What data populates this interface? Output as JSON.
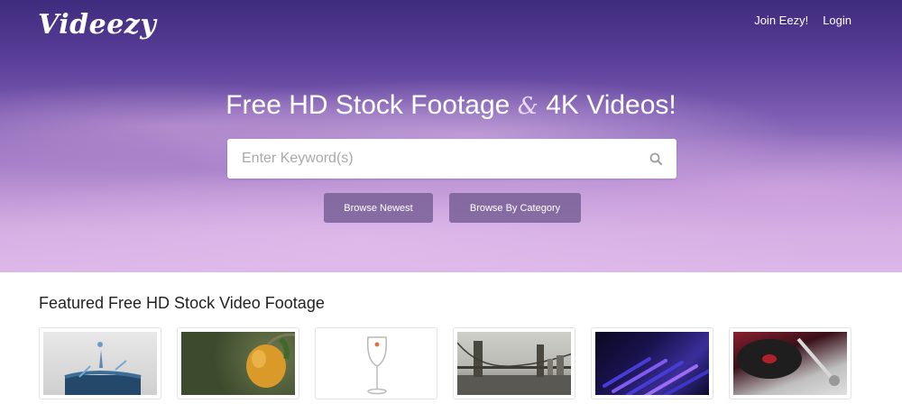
{
  "header": {
    "logo": "Videezy",
    "nav": [
      "Join Eezy!",
      "Login"
    ]
  },
  "hero": {
    "headline_part1": "Free HD Stock Footage",
    "headline_amp": "&",
    "headline_part2": "4K Videos!",
    "search_placeholder": "Enter Keyword(s)",
    "buttons": [
      "Browse Newest",
      "Browse By Category"
    ]
  },
  "featured": {
    "title": "Featured Free HD Stock Video Footage",
    "thumbnails": [
      "water-splash",
      "lemon-branch",
      "wine-glass",
      "bridge-city",
      "blue-light-streaks",
      "turntable"
    ]
  },
  "colors": {
    "accent": "#6c5690",
    "hero_top": "#3e2c7e",
    "hero_bottom": "#dcb7e8"
  }
}
